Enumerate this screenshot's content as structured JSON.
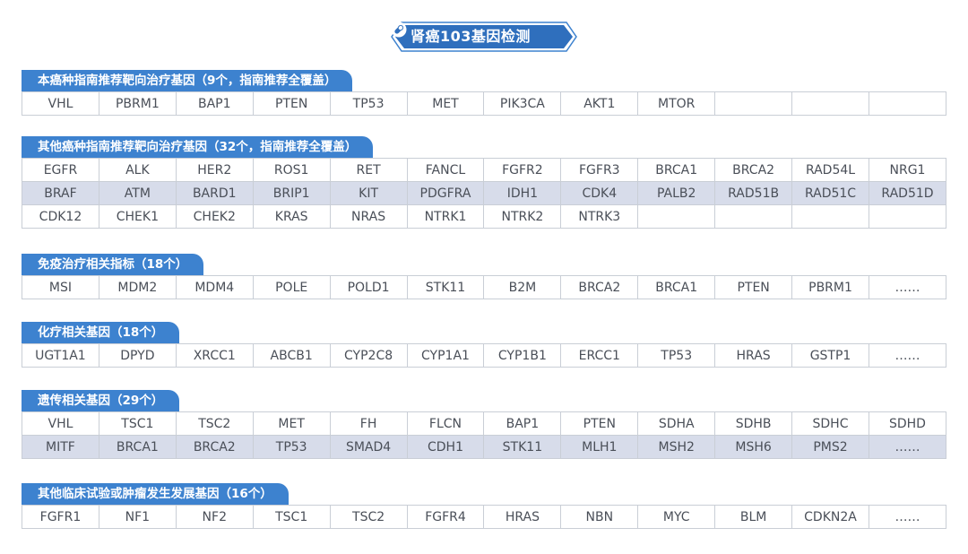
{
  "title": "肾癌103基因检测",
  "colors": {
    "accent": "#3d82cf",
    "title_bg": "#2f6fbd",
    "row_shade": "#d7dcea",
    "border": "#c9ced6"
  },
  "sections": [
    {
      "header": "本癌种指南推荐靶向治疗基因（9个，指南推荐全覆盖）",
      "rows": [
        [
          "VHL",
          "PBRM1",
          "BAP1",
          "PTEN",
          "TP53",
          "MET",
          "PIK3CA",
          "AKT1",
          "MTOR",
          "",
          "",
          ""
        ]
      ]
    },
    {
      "header": "其他癌种指南推荐靶向治疗基因（32个，指南推荐全覆盖）",
      "rows": [
        [
          "EGFR",
          "ALK",
          "HER2",
          "ROS1",
          "RET",
          "FANCL",
          "FGFR2",
          "FGFR3",
          "BRCA1",
          "BRCA2",
          "RAD54L",
          "NRG1"
        ],
        [
          "BRAF",
          "ATM",
          "BARD1",
          "BRIP1",
          "KIT",
          "PDGFRA",
          "IDH1",
          "CDK4",
          "PALB2",
          "RAD51B",
          "RAD51C",
          "RAD51D"
        ],
        [
          "CDK12",
          "CHEK1",
          "CHEK2",
          "KRAS",
          "NRAS",
          "NTRK1",
          "NTRK2",
          "NTRK3",
          "",
          "",
          "",
          ""
        ]
      ]
    },
    {
      "header": "免疫治疗相关指标（18个）",
      "rows": [
        [
          "MSI",
          "MDM2",
          "MDM4",
          "POLE",
          "POLD1",
          "STK11",
          "B2M",
          "BRCA2",
          "BRCA1",
          "PTEN",
          "PBRM1",
          "……"
        ]
      ]
    },
    {
      "header": "化疗相关基因（18个）",
      "rows": [
        [
          "UGT1A1",
          "DPYD",
          "XRCC1",
          "ABCB1",
          "CYP2C8",
          "CYP1A1",
          "CYP1B1",
          "ERCC1",
          "TP53",
          "HRAS",
          "GSTP1",
          "……"
        ]
      ]
    },
    {
      "header": "遗传相关基因（29个）",
      "rows": [
        [
          "VHL",
          "TSC1",
          "TSC2",
          "MET",
          "FH",
          "FLCN",
          "BAP1",
          "PTEN",
          "SDHA",
          "SDHB",
          "SDHC",
          "SDHD"
        ],
        [
          "MITF",
          "BRCA1",
          "BRCA2",
          "TP53",
          "SMAD4",
          "CDH1",
          "STK11",
          "MLH1",
          "MSH2",
          "MSH6",
          "PMS2",
          "……"
        ]
      ]
    },
    {
      "header": "其他临床试验或肿瘤发生发展基因（16个）",
      "rows": [
        [
          "FGFR1",
          "NF1",
          "NF2",
          "TSC1",
          "TSC2",
          "FGFR4",
          "HRAS",
          "NBN",
          "MYC",
          "BLM",
          "CDKN2A",
          "……"
        ]
      ]
    }
  ]
}
